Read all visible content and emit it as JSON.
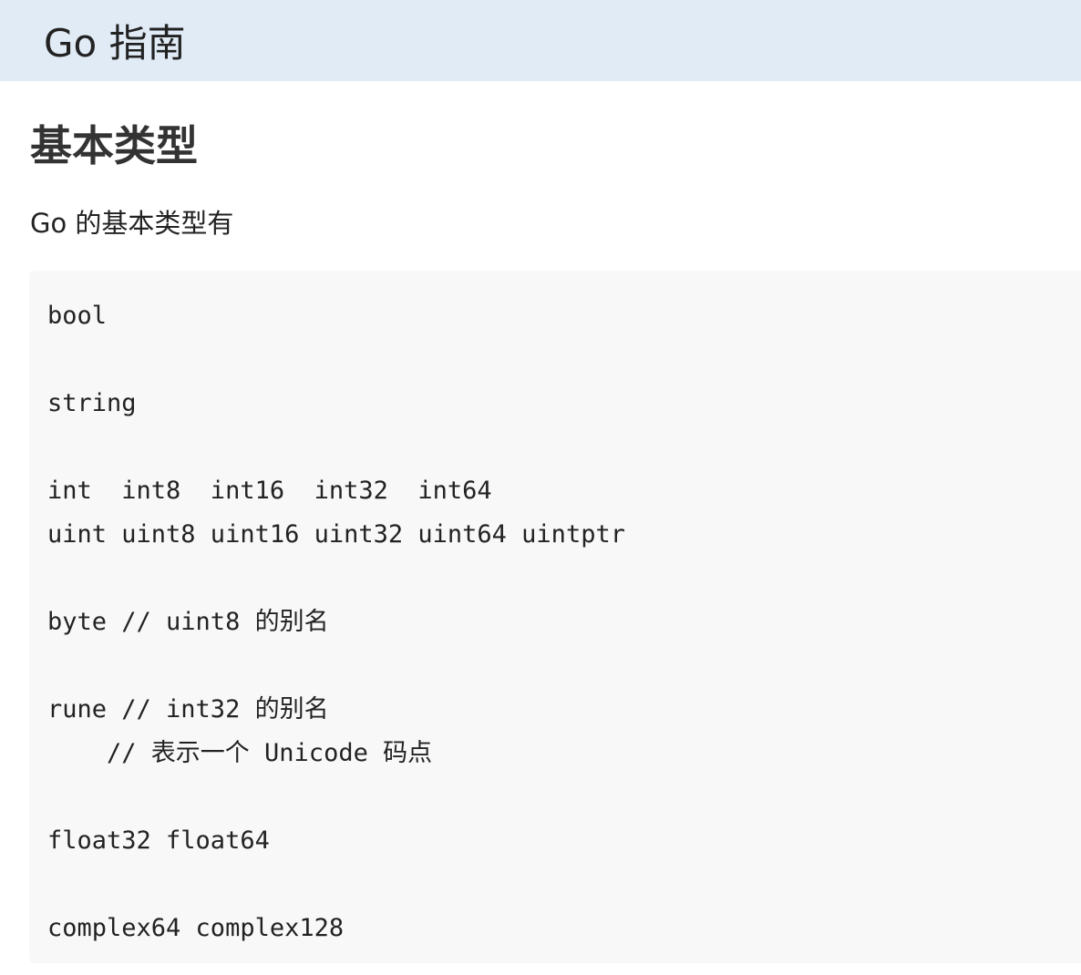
{
  "header": {
    "title": "Go 指南"
  },
  "section": {
    "title": "基本类型",
    "intro": "Go 的基本类型有",
    "code": "bool\n\nstring\n\nint  int8  int16  int32  int64\nuint uint8 uint16 uint32 uint64 uintptr\n\nbyte // uint8 的别名\n\nrune // int32 的别名\n    // 表示一个 Unicode 码点\n\nfloat32 float64\n\ncomplex64 complex128"
  }
}
